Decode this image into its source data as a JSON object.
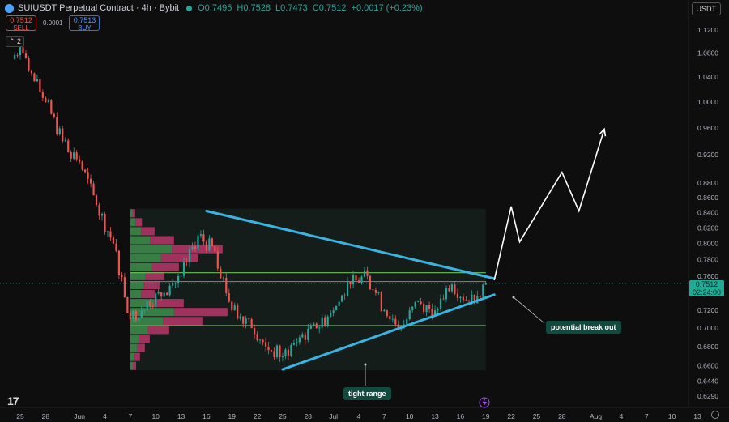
{
  "header": {
    "symbol": "SUIUSDT Perpetual Contract · 4h · Bybit",
    "open": "O0.7495",
    "high": "H0.7528",
    "low": "L0.7473",
    "close": "C0.7512",
    "change": "+0.0017 (+0.23%)",
    "currency": "USDT"
  },
  "orders": {
    "sell_price": "0.7512",
    "sell_label": "SELL",
    "spread": "0.0001",
    "buy_price": "0.7513",
    "buy_label": "BUY"
  },
  "indicator_badge": "2",
  "price_label": {
    "price": "0.7512",
    "countdown": "02:24:00"
  },
  "annotations": {
    "breakout": "potential break out",
    "range": "tight range"
  },
  "colors": {
    "background": "#0e0e0e",
    "up": "#26a69a",
    "down": "#ef5350",
    "trendline": "#3bb3e0",
    "poc_line": "#e24c4c",
    "value_area_line": "#6bbf59",
    "profile_up": "#3e8e4c",
    "profile_down": "#b8376a"
  },
  "chart_data": {
    "type": "candlestick",
    "timeframe": "4h",
    "y_axis": {
      "scale": "log",
      "ticks": [
        "1.1200",
        "1.0800",
        "1.0400",
        "1.0000",
        "0.9600",
        "0.9200",
        "0.8800",
        "0.8600",
        "0.8400",
        "0.8200",
        "0.8000",
        "0.7800",
        "0.7600",
        "0.7400",
        "0.7200",
        "0.7000",
        "0.6800",
        "0.6600",
        "0.6440",
        "0.6290"
      ]
    },
    "x_axis": {
      "ticks": [
        "25",
        "28",
        "Jun",
        "4",
        "7",
        "10",
        "13",
        "16",
        "19",
        "22",
        "25",
        "28",
        "Jul",
        "4",
        "7",
        "10",
        "13",
        "16",
        "19",
        "22",
        "25",
        "28",
        "Aug",
        "4",
        "7",
        "10",
        "13"
      ]
    },
    "price_path": [
      {
        "date": "May 24",
        "price": 1.07
      },
      {
        "date": "May 25",
        "price": 1.09
      },
      {
        "date": "May 26",
        "price": 1.05
      },
      {
        "date": "May 28",
        "price": 1.0
      },
      {
        "date": "May 30",
        "price": 0.94
      },
      {
        "date": "Jun 1",
        "price": 0.91
      },
      {
        "date": "Jun 3",
        "price": 0.85
      },
      {
        "date": "Jun 5",
        "price": 0.8
      },
      {
        "date": "Jun 7",
        "price": 0.71
      },
      {
        "date": "Jun 9",
        "price": 0.73
      },
      {
        "date": "Jun 11",
        "price": 0.74
      },
      {
        "date": "Jun 13",
        "price": 0.76
      },
      {
        "date": "Jun 15",
        "price": 0.81
      },
      {
        "date": "Jun 17",
        "price": 0.79
      },
      {
        "date": "Jun 19",
        "price": 0.72
      },
      {
        "date": "Jun 21",
        "price": 0.71
      },
      {
        "date": "Jun 23",
        "price": 0.68
      },
      {
        "date": "Jun 25",
        "price": 0.67
      },
      {
        "date": "Jun 27",
        "price": 0.69
      },
      {
        "date": "Jun 29",
        "price": 0.7
      },
      {
        "date": "Jul 1",
        "price": 0.72
      },
      {
        "date": "Jul 3",
        "price": 0.75
      },
      {
        "date": "Jul 5",
        "price": 0.76
      },
      {
        "date": "Jul 7",
        "price": 0.72
      },
      {
        "date": "Jul 9",
        "price": 0.7
      },
      {
        "date": "Jul 11",
        "price": 0.73
      },
      {
        "date": "Jul 13",
        "price": 0.72
      },
      {
        "date": "Jul 15",
        "price": 0.75
      },
      {
        "date": "Jul 17",
        "price": 0.73
      },
      {
        "date": "Jul 19",
        "price": 0.7512
      }
    ],
    "last_price": 0.7512,
    "horizontal_levels": [
      {
        "price": 0.764,
        "role": "value area high"
      },
      {
        "price": 0.7535,
        "role": "point of control"
      },
      {
        "price": 0.703,
        "role": "value area low"
      }
    ],
    "volume_profile": {
      "range": {
        "from": "Jun 7",
        "to": "Jul 19",
        "price_low": 0.655,
        "price_high": 0.845
      },
      "profile_weights": [
        0.05,
        0.12,
        0.25,
        0.45,
        0.95,
        0.7,
        0.5,
        0.35,
        0.3,
        0.25,
        0.55,
        1.0,
        0.75,
        0.4,
        0.2,
        0.15,
        0.1,
        0.06
      ]
    },
    "trendlines": [
      {
        "from": {
          "date": "Jun 16",
          "price": 0.842
        },
        "to": {
          "date": "Jul 20",
          "price": 0.757
        },
        "role": "descending resistance"
      },
      {
        "from": {
          "date": "Jun 25",
          "price": 0.656
        },
        "to": {
          "date": "Jul 20",
          "price": 0.738
        },
        "role": "ascending support"
      }
    ],
    "projection": [
      {
        "date": "Jul 20",
        "price": 0.755
      },
      {
        "date": "Jul 22",
        "price": 0.848
      },
      {
        "date": "Jul 23",
        "price": 0.802
      },
      {
        "date": "Jul 28",
        "price": 0.895
      },
      {
        "date": "Jul 30",
        "price": 0.842
      },
      {
        "date": "Aug 2",
        "price": 0.958
      }
    ]
  }
}
